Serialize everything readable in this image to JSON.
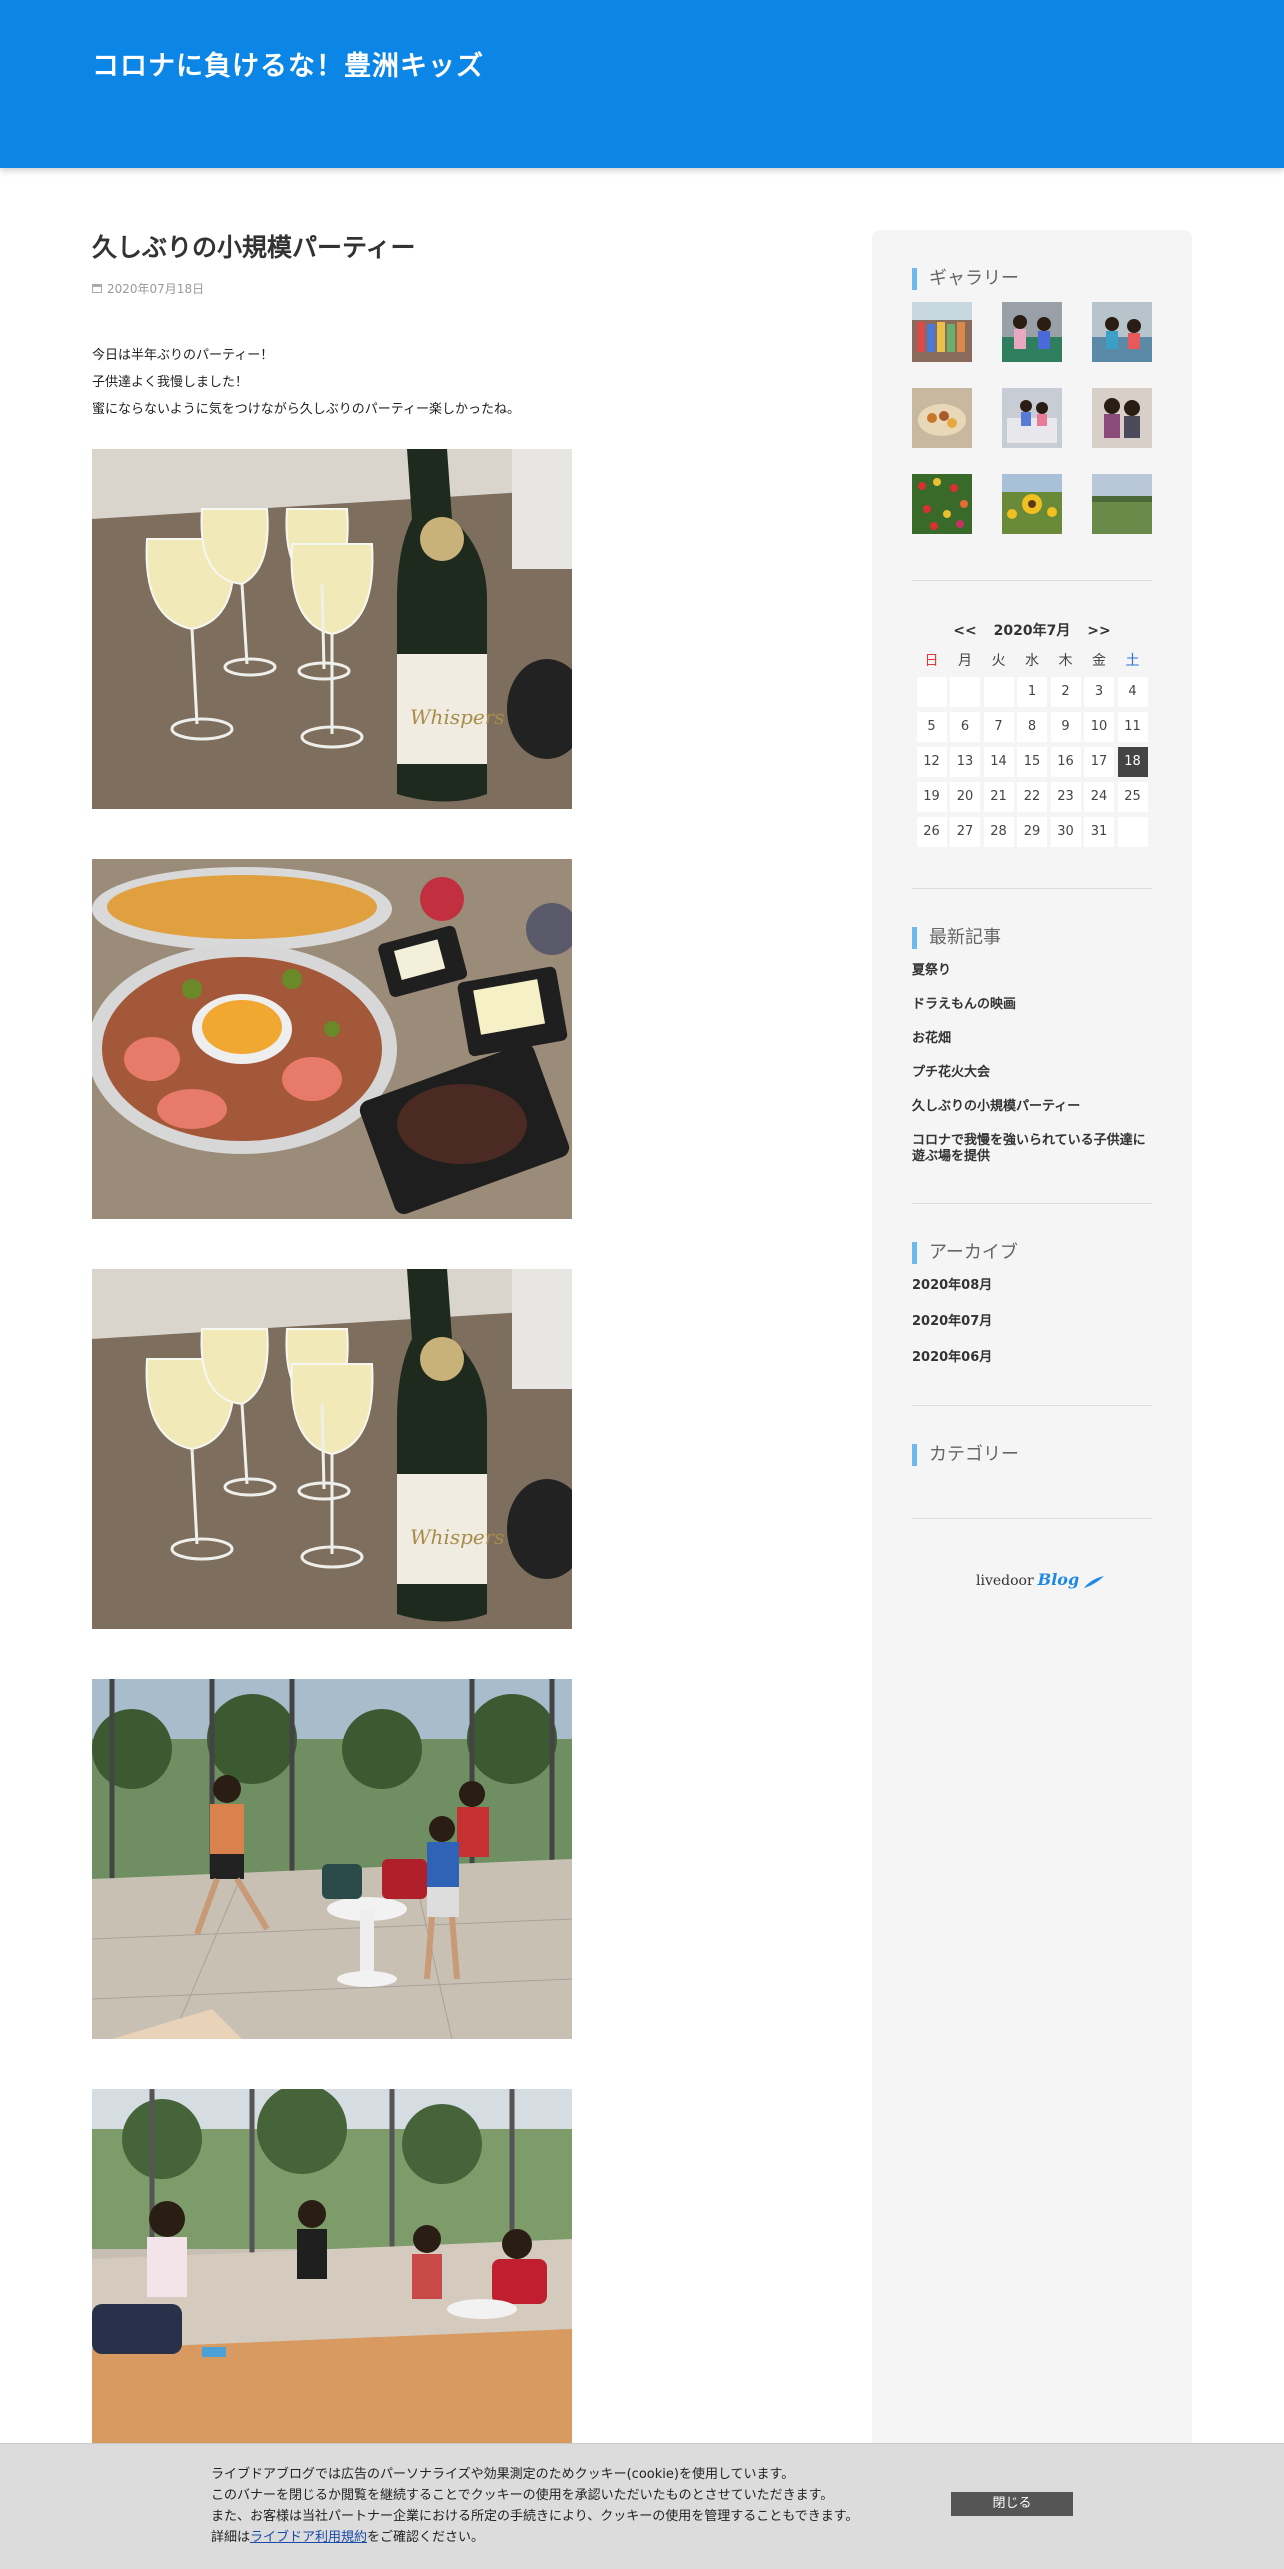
{
  "header": {
    "site_title": "コロナに負けるな！豊洲キッズ"
  },
  "post": {
    "title": "久しぶりの小規模パーティー",
    "date": "2020年07月18日",
    "body": [
      "今日は半年ぶりのパーティー！",
      "子供達よく我慢しました！",
      "蜜にならないように気をつけながら久しぶりのパーティー楽しかったね。"
    ],
    "bottle_label": "Whispers"
  },
  "sidebar": {
    "gallery_title": "ギャラリー",
    "calendar": {
      "prev": "<<",
      "month": "2020年7月",
      "next": ">>",
      "weekdays": [
        "日",
        "月",
        "火",
        "水",
        "木",
        "金",
        "土"
      ],
      "days": [
        "",
        "",
        "",
        "1",
        "2",
        "3",
        "4",
        "5",
        "6",
        "7",
        "8",
        "9",
        "10",
        "11",
        "12",
        "13",
        "14",
        "15",
        "16",
        "17",
        "18",
        "19",
        "20",
        "21",
        "22",
        "23",
        "24",
        "25",
        "26",
        "27",
        "28",
        "29",
        "30",
        "31",
        ""
      ],
      "today": "18"
    },
    "recent_title": "最新記事",
    "recent": [
      "夏祭り",
      "ドラえもんの映画",
      "お花畑",
      "プチ花火大会",
      "久しぶりの小規模パーティー",
      "コロナで我慢を強いられている子供達に遊ぶ場を提供"
    ],
    "archive_title": "アーカイブ",
    "archives": [
      "2020年08月",
      "2020年07月",
      "2020年06月"
    ],
    "category_title": "カテゴリー",
    "livedoor": "livedoor",
    "blog": "Blog"
  },
  "cookie": {
    "line1": "ライブドアブログでは広告のパーソナライズや効果測定のためクッキー(cookie)を使用しています。",
    "line2": "このバナーを閉じるか閲覧を継続することでクッキーの使用を承認いただいたものとさせていただきます。",
    "line3": "また、お客様は当社パートナー企業における所定の手続きにより、クッキーの使用を管理することもできます。",
    "prefix": "詳細は",
    "link": "ライブドア利用規約",
    "suffix": "をご確認ください。",
    "close": "閉じる"
  }
}
